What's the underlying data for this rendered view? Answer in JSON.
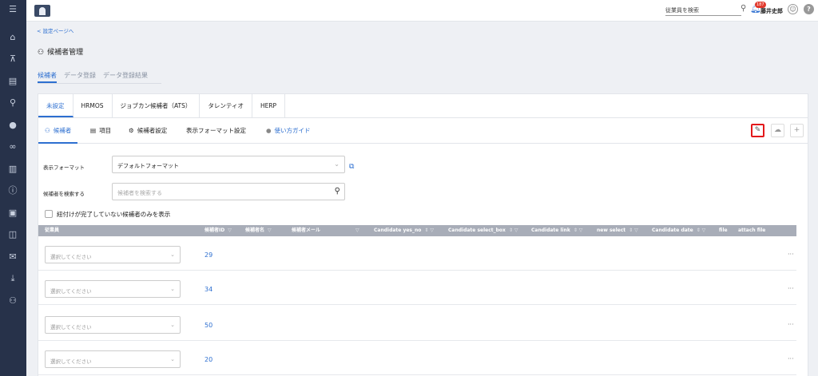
{
  "topbar": {
    "search_placeholder": "従業員を検索",
    "notification_count": "187",
    "user_name": "藤井史郎",
    "help_glyph": "?"
  },
  "back_link": "< 設定ページへ",
  "page_title": "候補者管理",
  "main_tabs": [
    {
      "label": "候補者"
    },
    {
      "label": "データ登録"
    },
    {
      "label": "データ登録結果"
    }
  ],
  "source_tabs": [
    {
      "label": "未設定"
    },
    {
      "label": "HRMOS"
    },
    {
      "label": "ジョブカン候補者（ATS）"
    },
    {
      "label": "タレンティオ"
    },
    {
      "label": "HERP"
    }
  ],
  "sub_tabs": {
    "candidates": "候補者",
    "items": "項目",
    "candidate_settings": "候補者設定",
    "display_format_settings": "表示フォーマット設定",
    "guide": "使い方ガイド"
  },
  "filters": {
    "format_label": "表示フォーマット",
    "format_value": "デフォルトフォーマット",
    "search_label": "候補者を検索する",
    "search_placeholder": "候補者を検索する",
    "checkbox_label": "紐付けが完了していない候補者のみを表示"
  },
  "table": {
    "headers": [
      "従業員",
      "候補者ID",
      "候補者名",
      "候補者メール",
      "Candidate yes_no",
      "Candidate select_box",
      "Candidate link",
      "new select",
      "Candidate date",
      "file",
      "attach file"
    ],
    "select_placeholder": "選択してください",
    "more_glyph": "···",
    "rows": [
      {
        "id": "29"
      },
      {
        "id": "34"
      },
      {
        "id": "50"
      },
      {
        "id": "20"
      }
    ]
  }
}
